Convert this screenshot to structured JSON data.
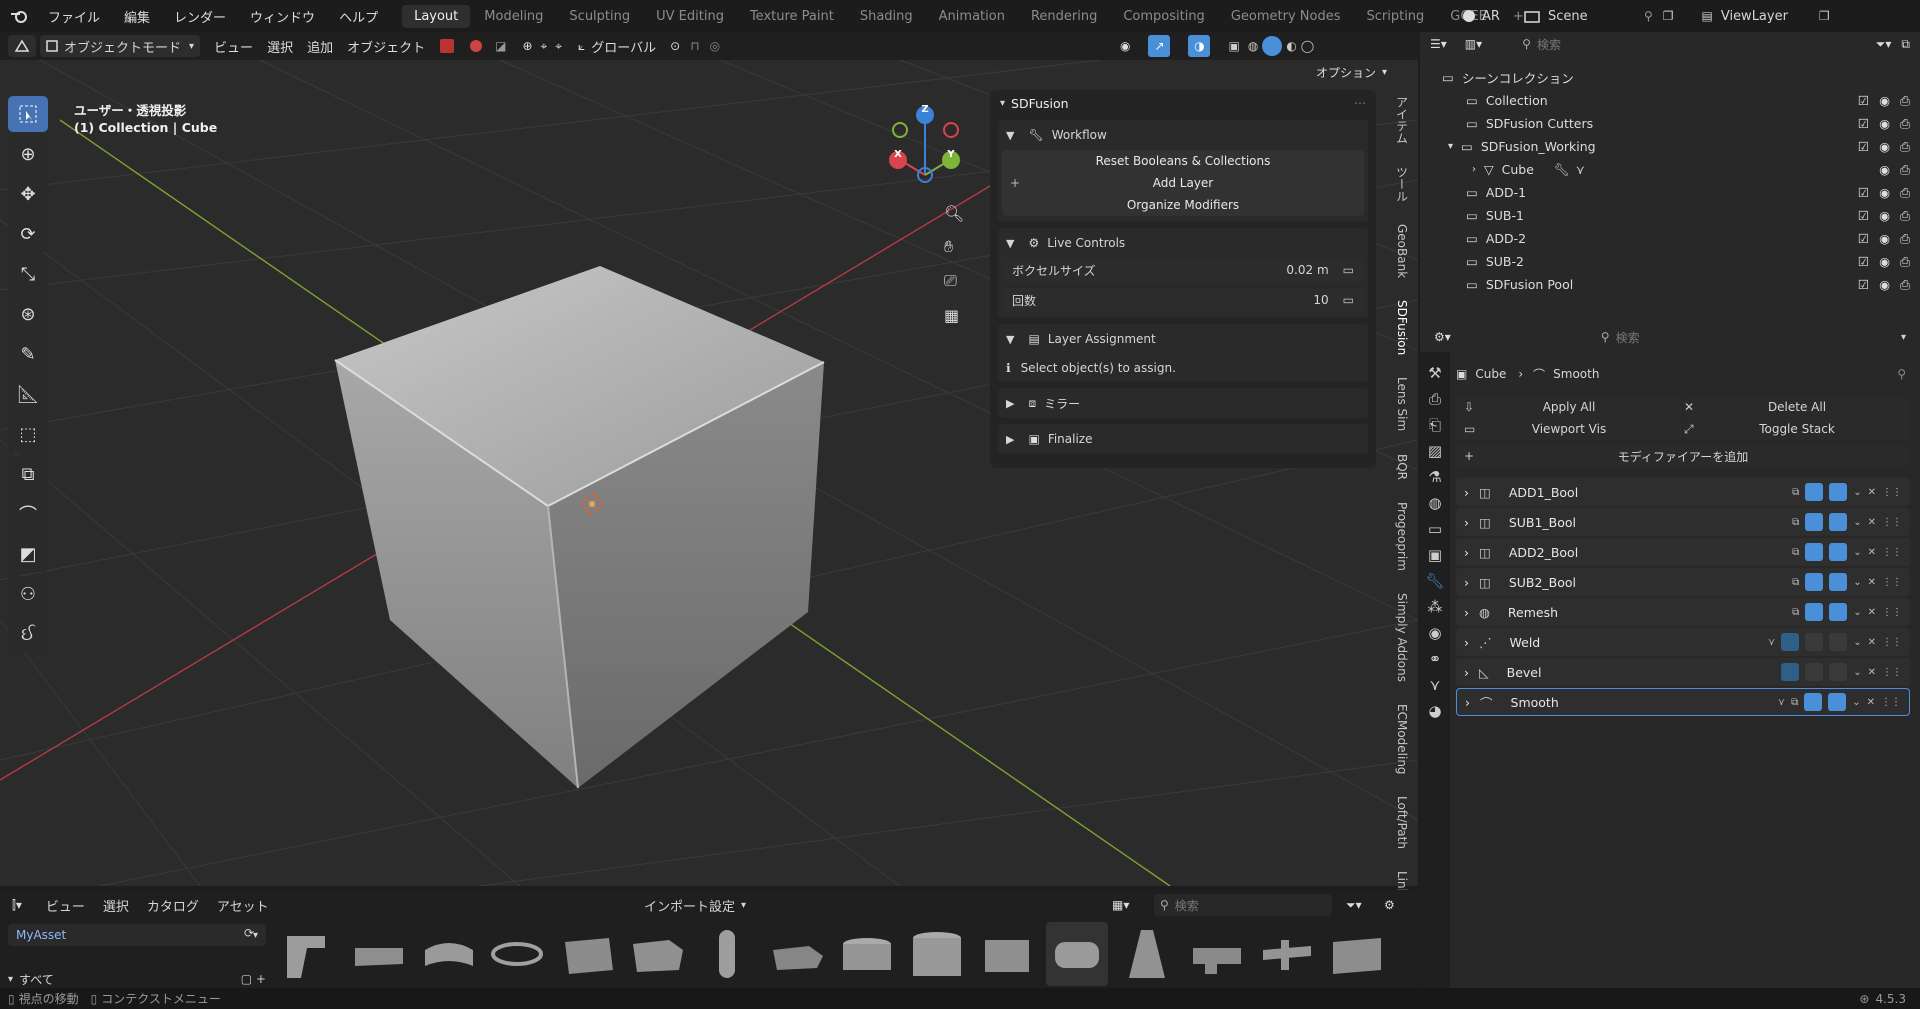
{
  "topbar": {
    "menus": [
      "ファイル",
      "編集",
      "レンダー",
      "ウィンドウ",
      "ヘルプ"
    ],
    "workspaces": [
      "Layout",
      "Modeling",
      "Sculpting",
      "UV Editing",
      "Texture Paint",
      "Shading",
      "Animation",
      "Rendering",
      "Compositing",
      "Geometry Nodes",
      "Scripting",
      "GGEE"
    ],
    "active_workspace": "Layout",
    "ar_label": "AR",
    "scene": "Scene",
    "view_layer": "ViewLayer"
  },
  "viewport_header": {
    "mode": "オブジェクトモード",
    "menus": [
      "ビュー",
      "選択",
      "追加",
      "オブジェクト"
    ],
    "transform_orientation": "グローバル",
    "options": "オプション"
  },
  "viewport": {
    "view_name": "ユーザー・透視投影",
    "collection_info": "(1) Collection | Cube",
    "gizmo_axes": [
      "X",
      "Y",
      "Z"
    ]
  },
  "npanel": {
    "title": "SDFusion",
    "workflow": {
      "title": "Workflow",
      "buttons": [
        "Reset Booleans & Collections",
        "Add Layer",
        "Organize Modifiers"
      ]
    },
    "live_controls": {
      "title": "Live Controls",
      "fields": [
        {
          "label": "ボクセルサイズ",
          "value": "0.02 m"
        },
        {
          "label": "回数",
          "value": "10"
        }
      ]
    },
    "layer_assignment": {
      "title": "Layer Assignment",
      "info": "Select object(s) to assign."
    },
    "mirror": "ミラー",
    "finalize": "Finalize"
  },
  "vertical_tabs": [
    "アイテム",
    "ツール",
    "GeoBank",
    "SDFusion",
    "Lens Sim",
    "BQR",
    "Progeoprim",
    "Simply Addons",
    "ECModeling",
    "Loft/Path",
    "Link Curve"
  ],
  "asset_browser": {
    "menus": [
      "ビュー",
      "選択",
      "カタログ",
      "アセット"
    ],
    "import_settings": "インポート設定",
    "search_placeholder": "検索",
    "library": "MyAsset",
    "catalog_all": "すべて"
  },
  "statusbar": {
    "left1": "視点の移動",
    "left2": "コンテクストメニュー",
    "version": "4.5.3"
  },
  "outliner": {
    "search_placeholder": "検索",
    "root": "シーンコレクション",
    "items": [
      {
        "name": "Collection",
        "indent": 1
      },
      {
        "name": "SDFusion Cutters",
        "indent": 1
      },
      {
        "name": "SDFusion_Working",
        "indent": 1
      },
      {
        "name": "Cube",
        "indent": 2
      },
      {
        "name": "ADD-1",
        "indent": 1
      },
      {
        "name": "SUB-1",
        "indent": 1
      },
      {
        "name": "ADD-2",
        "indent": 1
      },
      {
        "name": "SUB-2",
        "indent": 1
      },
      {
        "name": "SDFusion Pool",
        "indent": 1
      }
    ]
  },
  "properties": {
    "search_placeholder": "検索",
    "breadcrumb_object": "Cube",
    "breadcrumb_modifier": "Smooth",
    "apply_all": "Apply All",
    "delete_all": "Delete All",
    "viewport_vis": "Viewport Vis",
    "toggle_stack": "Toggle Stack",
    "add_modifier": "モディファイアーを追加",
    "modifiers": [
      {
        "name": "ADD1_Bool",
        "vp_on": true,
        "render_on": true,
        "selected": false
      },
      {
        "name": "SUB1_Bool",
        "vp_on": true,
        "render_on": true,
        "selected": false
      },
      {
        "name": "ADD2_Bool",
        "vp_on": true,
        "render_on": true,
        "selected": false
      },
      {
        "name": "SUB2_Bool",
        "vp_on": true,
        "render_on": true,
        "selected": false
      },
      {
        "name": "Remesh",
        "vp_on": true,
        "render_on": true,
        "selected": false
      },
      {
        "name": "Weld",
        "vp_on": false,
        "render_on": false,
        "selected": false
      },
      {
        "name": "Bevel",
        "vp_on": false,
        "render_on": false,
        "selected": false
      },
      {
        "name": "Smooth",
        "vp_on": true,
        "render_on": true,
        "selected": true
      }
    ]
  },
  "colors": {
    "accent": "#4772b3",
    "toggle_on": "#4a90d9",
    "x_axis": "#d9444f",
    "y_axis": "#7fb43a",
    "z_axis": "#3b82d9"
  }
}
